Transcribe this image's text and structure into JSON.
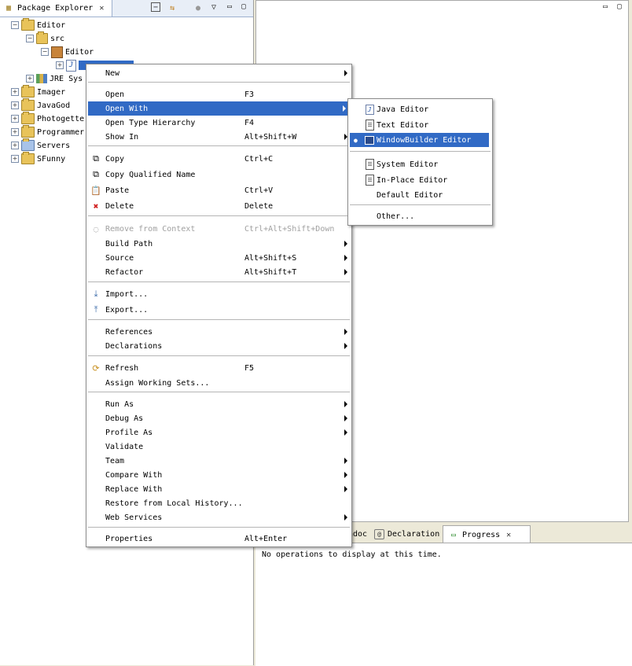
{
  "package_explorer": {
    "tab_label": "Package Explorer",
    "tree": [
      {
        "label": "Editor",
        "expander": "−"
      },
      {
        "label": "src",
        "expander": "−"
      },
      {
        "label": "Editor",
        "expander": "−"
      },
      {
        "label": "",
        "expander": "+"
      },
      {
        "label": "JRE Sys",
        "expander": "+"
      },
      {
        "label": "Imager",
        "expander": "+"
      },
      {
        "label": "JavaGod",
        "expander": "+"
      },
      {
        "label": "Photogette",
        "expander": "+"
      },
      {
        "label": "Programmer",
        "expander": "+"
      },
      {
        "label": "Servers",
        "expander": "+"
      },
      {
        "label": "SFunny",
        "expander": "+"
      }
    ]
  },
  "bottom_panel": {
    "tabs": [
      "adoc",
      "Declaration",
      "Progress"
    ],
    "message": "No operations to display at this time."
  },
  "context_menu": {
    "items": [
      {
        "label": "New",
        "accel": "",
        "submenu": true
      },
      {
        "label": "Open",
        "accel": "F3"
      },
      {
        "label": "Open With",
        "accel": "",
        "submenu": true
      },
      {
        "label": "Open Type Hierarchy",
        "accel": "F4"
      },
      {
        "label": "Show In",
        "accel": "Alt+Shift+W",
        "submenu": true
      },
      {
        "label": "Copy",
        "accel": "Ctrl+C"
      },
      {
        "label": "Copy Qualified Name",
        "accel": ""
      },
      {
        "label": "Paste",
        "accel": "Ctrl+V"
      },
      {
        "label": "Delete",
        "accel": "Delete"
      },
      {
        "label": "Remove from Context",
        "accel": "Ctrl+Alt+Shift+Down"
      },
      {
        "label": "Build Path",
        "accel": "",
        "submenu": true
      },
      {
        "label": "Source",
        "accel": "Alt+Shift+S",
        "submenu": true
      },
      {
        "label": "Refactor",
        "accel": "Alt+Shift+T",
        "submenu": true
      },
      {
        "label": "Import...",
        "accel": ""
      },
      {
        "label": "Export...",
        "accel": ""
      },
      {
        "label": "References",
        "accel": "",
        "submenu": true
      },
      {
        "label": "Declarations",
        "accel": "",
        "submenu": true
      },
      {
        "label": "Refresh",
        "accel": "F5"
      },
      {
        "label": "Assign Working Sets...",
        "accel": ""
      },
      {
        "label": "Run As",
        "accel": "",
        "submenu": true
      },
      {
        "label": "Debug As",
        "accel": "",
        "submenu": true
      },
      {
        "label": "Profile As",
        "accel": "",
        "submenu": true
      },
      {
        "label": "Validate",
        "accel": ""
      },
      {
        "label": "Team",
        "accel": "",
        "submenu": true
      },
      {
        "label": "Compare With",
        "accel": "",
        "submenu": true
      },
      {
        "label": "Replace With",
        "accel": "",
        "submenu": true
      },
      {
        "label": "Restore from Local History...",
        "accel": ""
      },
      {
        "label": "Web Services",
        "accel": "",
        "submenu": true
      },
      {
        "label": "Properties",
        "accel": "Alt+Enter"
      }
    ]
  },
  "open_with_submenu": {
    "items": [
      "Java Editor",
      "Text Editor",
      "WindowBuilder Editor",
      "System Editor",
      "In-Place Editor",
      "Default Editor",
      "Other..."
    ]
  },
  "colors": {
    "highlight": "#316ac5",
    "delete_icon": "#d02020"
  }
}
